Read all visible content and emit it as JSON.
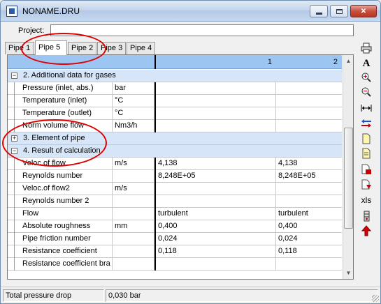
{
  "window": {
    "title": "NONAME.DRU"
  },
  "project": {
    "label": "Project:",
    "value": ""
  },
  "tabs": [
    "Pipe 1",
    "Pipe 5",
    "Pipe 2",
    "Pipe 3",
    "Pipe 4"
  ],
  "active_tab": "Pipe 5",
  "grid": {
    "column_headers": [
      "1",
      "2"
    ],
    "rows": [
      {
        "kind": "section",
        "expander": "−",
        "title": "2. Additional data for gases"
      },
      {
        "kind": "data",
        "name": "Pressure (inlet, abs.)",
        "unit": "bar",
        "v1": "",
        "v2": ""
      },
      {
        "kind": "data",
        "name": "Temperature (inlet)",
        "unit": "°C",
        "v1": "",
        "v2": ""
      },
      {
        "kind": "data",
        "name": "Temperature (outlet)",
        "unit": "°C",
        "v1": "",
        "v2": ""
      },
      {
        "kind": "data",
        "name": "Norm volume flow",
        "unit": "Nm3/h",
        "v1": "",
        "v2": ""
      },
      {
        "kind": "section",
        "expander": "+",
        "title": "3. Element of pipe"
      },
      {
        "kind": "section",
        "expander": "−",
        "title": "4. Result of calculation"
      },
      {
        "kind": "data",
        "name": "Veloc.of flow",
        "unit": "m/s",
        "v1": "4,138",
        "v2": "4,138"
      },
      {
        "kind": "data",
        "name": "Reynolds number",
        "unit": "",
        "v1": "8,248E+05",
        "v2": "8,248E+05"
      },
      {
        "kind": "data",
        "name": "Veloc.of flow2",
        "unit": "m/s",
        "v1": "",
        "v2": ""
      },
      {
        "kind": "data",
        "name": "Reynolds number 2",
        "unit": "",
        "v1": "",
        "v2": ""
      },
      {
        "kind": "data",
        "name": "Flow",
        "unit": "",
        "v1": "turbulent",
        "v2": "turbulent"
      },
      {
        "kind": "data",
        "name": "Absolute roughness",
        "unit": "mm",
        "v1": "0,400",
        "v2": "0,400"
      },
      {
        "kind": "data",
        "name": "Pipe friction number",
        "unit": "",
        "v1": "0,024",
        "v2": "0,024"
      },
      {
        "kind": "data",
        "name": "Resistance coefficient",
        "unit": "",
        "v1": "0,118",
        "v2": "0,118"
      },
      {
        "kind": "data",
        "name": "Resistance coefficient bra",
        "unit": "",
        "v1": "",
        "v2": ""
      }
    ]
  },
  "toolbar_icons": [
    "print-icon",
    "font-icon",
    "zoom-in-icon",
    "zoom-out-icon",
    "fit-width-icon",
    "swap-columns-icon",
    "new-document-icon",
    "copy-document-icon",
    "export-document-icon",
    "import-document-icon",
    "xls-export-icon",
    "excel-icon",
    "up-arrow-icon"
  ],
  "toolbar_text": {
    "font": "A",
    "xls": "xls"
  },
  "status": {
    "label": "Total pressure drop",
    "value": "0,030 bar"
  },
  "colors": {
    "header_blue": "#9cc5f2",
    "section_blue": "#d6e6f8",
    "annotation_red": "#e00000"
  }
}
